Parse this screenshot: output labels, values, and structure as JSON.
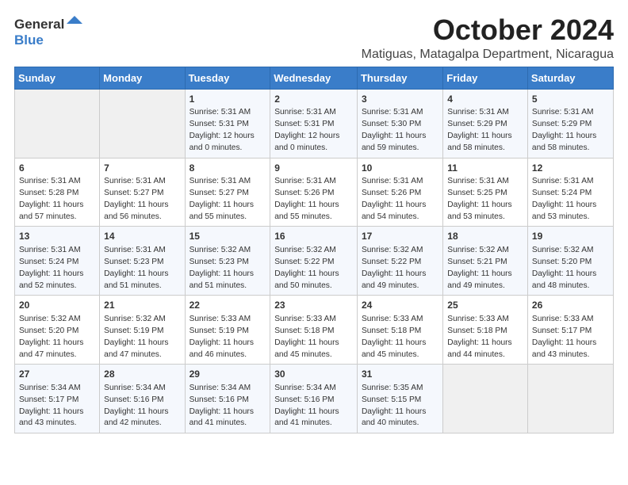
{
  "logo": {
    "general": "General",
    "blue": "Blue",
    "arrow_color": "#3a7dc9"
  },
  "title": "October 2024",
  "location": "Matiguas, Matagalpa Department, Nicaragua",
  "weekdays": [
    "Sunday",
    "Monday",
    "Tuesday",
    "Wednesday",
    "Thursday",
    "Friday",
    "Saturday"
  ],
  "weeks": [
    [
      {
        "day": "",
        "sunrise": "",
        "sunset": "",
        "daylight": ""
      },
      {
        "day": "",
        "sunrise": "",
        "sunset": "",
        "daylight": ""
      },
      {
        "day": "1",
        "sunrise": "Sunrise: 5:31 AM",
        "sunset": "Sunset: 5:31 PM",
        "daylight": "Daylight: 12 hours and 0 minutes."
      },
      {
        "day": "2",
        "sunrise": "Sunrise: 5:31 AM",
        "sunset": "Sunset: 5:31 PM",
        "daylight": "Daylight: 12 hours and 0 minutes."
      },
      {
        "day": "3",
        "sunrise": "Sunrise: 5:31 AM",
        "sunset": "Sunset: 5:30 PM",
        "daylight": "Daylight: 11 hours and 59 minutes."
      },
      {
        "day": "4",
        "sunrise": "Sunrise: 5:31 AM",
        "sunset": "Sunset: 5:29 PM",
        "daylight": "Daylight: 11 hours and 58 minutes."
      },
      {
        "day": "5",
        "sunrise": "Sunrise: 5:31 AM",
        "sunset": "Sunset: 5:29 PM",
        "daylight": "Daylight: 11 hours and 58 minutes."
      }
    ],
    [
      {
        "day": "6",
        "sunrise": "Sunrise: 5:31 AM",
        "sunset": "Sunset: 5:28 PM",
        "daylight": "Daylight: 11 hours and 57 minutes."
      },
      {
        "day": "7",
        "sunrise": "Sunrise: 5:31 AM",
        "sunset": "Sunset: 5:27 PM",
        "daylight": "Daylight: 11 hours and 56 minutes."
      },
      {
        "day": "8",
        "sunrise": "Sunrise: 5:31 AM",
        "sunset": "Sunset: 5:27 PM",
        "daylight": "Daylight: 11 hours and 55 minutes."
      },
      {
        "day": "9",
        "sunrise": "Sunrise: 5:31 AM",
        "sunset": "Sunset: 5:26 PM",
        "daylight": "Daylight: 11 hours and 55 minutes."
      },
      {
        "day": "10",
        "sunrise": "Sunrise: 5:31 AM",
        "sunset": "Sunset: 5:26 PM",
        "daylight": "Daylight: 11 hours and 54 minutes."
      },
      {
        "day": "11",
        "sunrise": "Sunrise: 5:31 AM",
        "sunset": "Sunset: 5:25 PM",
        "daylight": "Daylight: 11 hours and 53 minutes."
      },
      {
        "day": "12",
        "sunrise": "Sunrise: 5:31 AM",
        "sunset": "Sunset: 5:24 PM",
        "daylight": "Daylight: 11 hours and 53 minutes."
      }
    ],
    [
      {
        "day": "13",
        "sunrise": "Sunrise: 5:31 AM",
        "sunset": "Sunset: 5:24 PM",
        "daylight": "Daylight: 11 hours and 52 minutes."
      },
      {
        "day": "14",
        "sunrise": "Sunrise: 5:31 AM",
        "sunset": "Sunset: 5:23 PM",
        "daylight": "Daylight: 11 hours and 51 minutes."
      },
      {
        "day": "15",
        "sunrise": "Sunrise: 5:32 AM",
        "sunset": "Sunset: 5:23 PM",
        "daylight": "Daylight: 11 hours and 51 minutes."
      },
      {
        "day": "16",
        "sunrise": "Sunrise: 5:32 AM",
        "sunset": "Sunset: 5:22 PM",
        "daylight": "Daylight: 11 hours and 50 minutes."
      },
      {
        "day": "17",
        "sunrise": "Sunrise: 5:32 AM",
        "sunset": "Sunset: 5:22 PM",
        "daylight": "Daylight: 11 hours and 49 minutes."
      },
      {
        "day": "18",
        "sunrise": "Sunrise: 5:32 AM",
        "sunset": "Sunset: 5:21 PM",
        "daylight": "Daylight: 11 hours and 49 minutes."
      },
      {
        "day": "19",
        "sunrise": "Sunrise: 5:32 AM",
        "sunset": "Sunset: 5:20 PM",
        "daylight": "Daylight: 11 hours and 48 minutes."
      }
    ],
    [
      {
        "day": "20",
        "sunrise": "Sunrise: 5:32 AM",
        "sunset": "Sunset: 5:20 PM",
        "daylight": "Daylight: 11 hours and 47 minutes."
      },
      {
        "day": "21",
        "sunrise": "Sunrise: 5:32 AM",
        "sunset": "Sunset: 5:19 PM",
        "daylight": "Daylight: 11 hours and 47 minutes."
      },
      {
        "day": "22",
        "sunrise": "Sunrise: 5:33 AM",
        "sunset": "Sunset: 5:19 PM",
        "daylight": "Daylight: 11 hours and 46 minutes."
      },
      {
        "day": "23",
        "sunrise": "Sunrise: 5:33 AM",
        "sunset": "Sunset: 5:18 PM",
        "daylight": "Daylight: 11 hours and 45 minutes."
      },
      {
        "day": "24",
        "sunrise": "Sunrise: 5:33 AM",
        "sunset": "Sunset: 5:18 PM",
        "daylight": "Daylight: 11 hours and 45 minutes."
      },
      {
        "day": "25",
        "sunrise": "Sunrise: 5:33 AM",
        "sunset": "Sunset: 5:18 PM",
        "daylight": "Daylight: 11 hours and 44 minutes."
      },
      {
        "day": "26",
        "sunrise": "Sunrise: 5:33 AM",
        "sunset": "Sunset: 5:17 PM",
        "daylight": "Daylight: 11 hours and 43 minutes."
      }
    ],
    [
      {
        "day": "27",
        "sunrise": "Sunrise: 5:34 AM",
        "sunset": "Sunset: 5:17 PM",
        "daylight": "Daylight: 11 hours and 43 minutes."
      },
      {
        "day": "28",
        "sunrise": "Sunrise: 5:34 AM",
        "sunset": "Sunset: 5:16 PM",
        "daylight": "Daylight: 11 hours and 42 minutes."
      },
      {
        "day": "29",
        "sunrise": "Sunrise: 5:34 AM",
        "sunset": "Sunset: 5:16 PM",
        "daylight": "Daylight: 11 hours and 41 minutes."
      },
      {
        "day": "30",
        "sunrise": "Sunrise: 5:34 AM",
        "sunset": "Sunset: 5:16 PM",
        "daylight": "Daylight: 11 hours and 41 minutes."
      },
      {
        "day": "31",
        "sunrise": "Sunrise: 5:35 AM",
        "sunset": "Sunset: 5:15 PM",
        "daylight": "Daylight: 11 hours and 40 minutes."
      },
      {
        "day": "",
        "sunrise": "",
        "sunset": "",
        "daylight": ""
      },
      {
        "day": "",
        "sunrise": "",
        "sunset": "",
        "daylight": ""
      }
    ]
  ]
}
